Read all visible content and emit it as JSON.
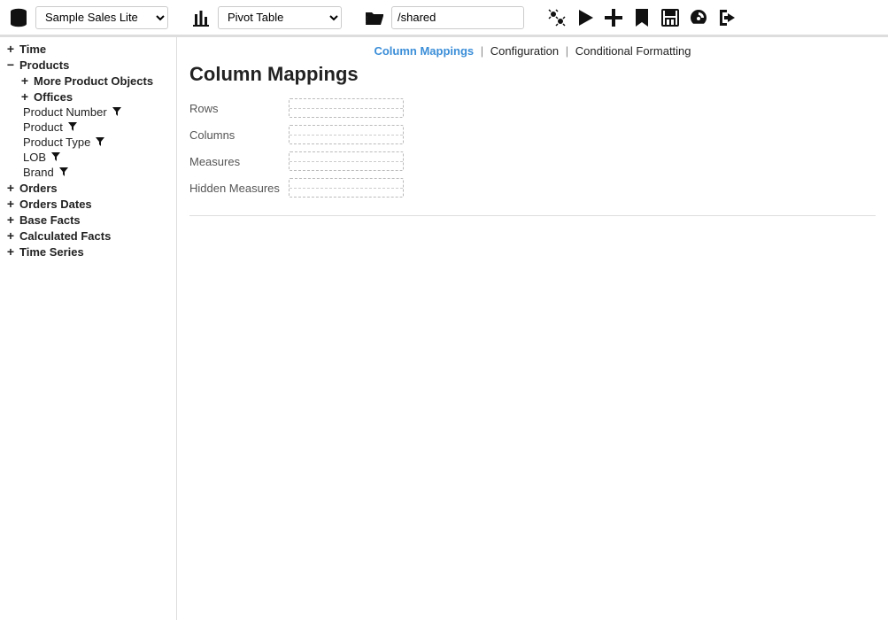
{
  "toolbar": {
    "dataset_select": "Sample Sales Lite",
    "view_select": "Pivot Table",
    "path_input": "/shared"
  },
  "sidebar": {
    "nodes": [
      {
        "expander": "+",
        "label": "Time"
      },
      {
        "expander": "−",
        "label": "Products"
      },
      {
        "expander": "+",
        "label": "More Product Objects",
        "indent": true
      },
      {
        "expander": "+",
        "label": "Offices",
        "indent": true
      },
      {
        "leaf": true,
        "label": "Product Number",
        "filter": true
      },
      {
        "leaf": true,
        "label": "Product",
        "filter": true
      },
      {
        "leaf": true,
        "label": "Product Type",
        "filter": true
      },
      {
        "leaf": true,
        "label": "LOB",
        "filter": true
      },
      {
        "leaf": true,
        "label": "Brand",
        "filter": true
      },
      {
        "expander": "+",
        "label": "Orders"
      },
      {
        "expander": "+",
        "label": "Orders Dates"
      },
      {
        "expander": "+",
        "label": "Base Facts"
      },
      {
        "expander": "+",
        "label": "Calculated Facts"
      },
      {
        "expander": "+",
        "label": "Time Series"
      }
    ]
  },
  "tabs": {
    "t0": "Column Mappings",
    "t1": "Configuration",
    "t2": "Conditional Formatting"
  },
  "page_title": "Column Mappings",
  "mappings": {
    "rows": "Rows",
    "columns": "Columns",
    "measures": "Measures",
    "hidden": "Hidden Measures"
  }
}
